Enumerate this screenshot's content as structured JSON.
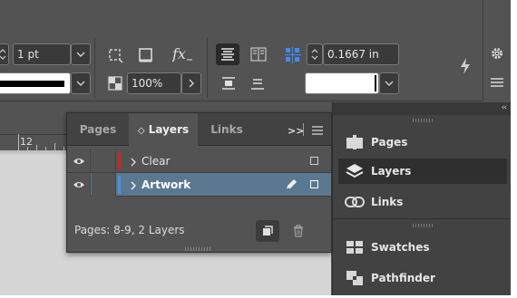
{
  "control_bar": {
    "stroke_weight": "1 pt",
    "opacity": "100%",
    "gutter": "0.1667 in"
  },
  "ruler": {
    "label": "12"
  },
  "layers_panel": {
    "tabs": [
      {
        "label": "Pages"
      },
      {
        "label": "Layers"
      },
      {
        "label": "Links"
      }
    ],
    "overflow_glyph": ">>",
    "layers": [
      {
        "name": "Clear",
        "color": "#d62020",
        "selected": false
      },
      {
        "name": "Artwork",
        "color": "#4f8fe0",
        "selected": true
      }
    ],
    "status": "Pages: 8-9, 2 Layers"
  },
  "dock": {
    "collapse_glyph": "‹‹",
    "items": [
      {
        "label": "Pages",
        "icon": "pages-icon",
        "active": false
      },
      {
        "label": "Layers",
        "icon": "layers-icon",
        "active": true
      },
      {
        "label": "Links",
        "icon": "links-icon",
        "active": false
      },
      {
        "label": "Swatches",
        "icon": "swatches-icon",
        "active": false
      },
      {
        "label": "Pathfinder",
        "icon": "pathfinder-icon",
        "active": false
      }
    ]
  },
  "colors": {
    "panel_bg": "#535353",
    "selected_row": "#5b7891"
  }
}
